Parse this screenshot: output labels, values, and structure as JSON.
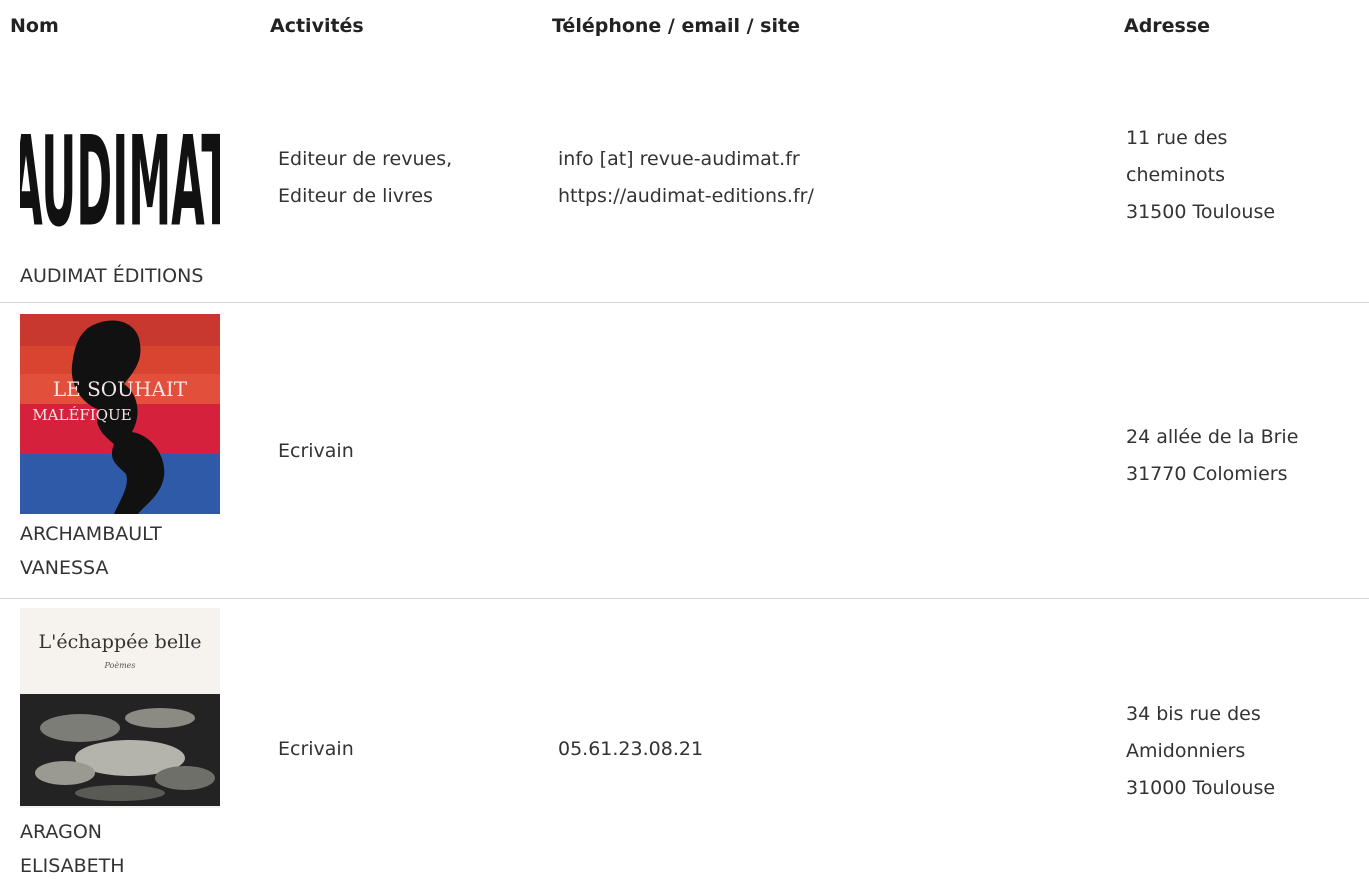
{
  "table": {
    "headers": {
      "name": "Nom",
      "activities": "Activités",
      "contact": "Téléphone / email / site",
      "address": "Adresse"
    },
    "rows": [
      {
        "image_icon": "audimat-logo",
        "image_text": "AUDIMAT",
        "name": "AUDIMAT ÉDITIONS",
        "activities": [
          "Editeur de revues,",
          "Editeur de livres"
        ],
        "contact": [
          "info [at] revue-audimat.fr",
          "https://audimat-editions.fr/"
        ],
        "address": [
          "11 rue des",
          "cheminots",
          "31500 Toulouse"
        ]
      },
      {
        "image_icon": "book-cover-le-souhait-malefique",
        "image_text": [
          "LE SOUHAIT",
          "MALÉFIQUE"
        ],
        "name": [
          "ARCHAMBAULT",
          "VANESSA"
        ],
        "activities": [
          "Ecrivain"
        ],
        "contact": [],
        "address": [
          "24 allée de la Brie",
          "31770 Colomiers"
        ]
      },
      {
        "image_icon": "book-cover-l-echappee-belle",
        "image_text": [
          "L'échappée belle",
          "Poèmes"
        ],
        "name": [
          "ARAGON",
          "ELISABETH"
        ],
        "activities": [
          "Ecrivain"
        ],
        "contact": [
          "05.61.23.08.21"
        ],
        "address": [
          "34 bis rue des",
          "Amidonniers",
          "31000 Toulouse"
        ]
      }
    ]
  }
}
